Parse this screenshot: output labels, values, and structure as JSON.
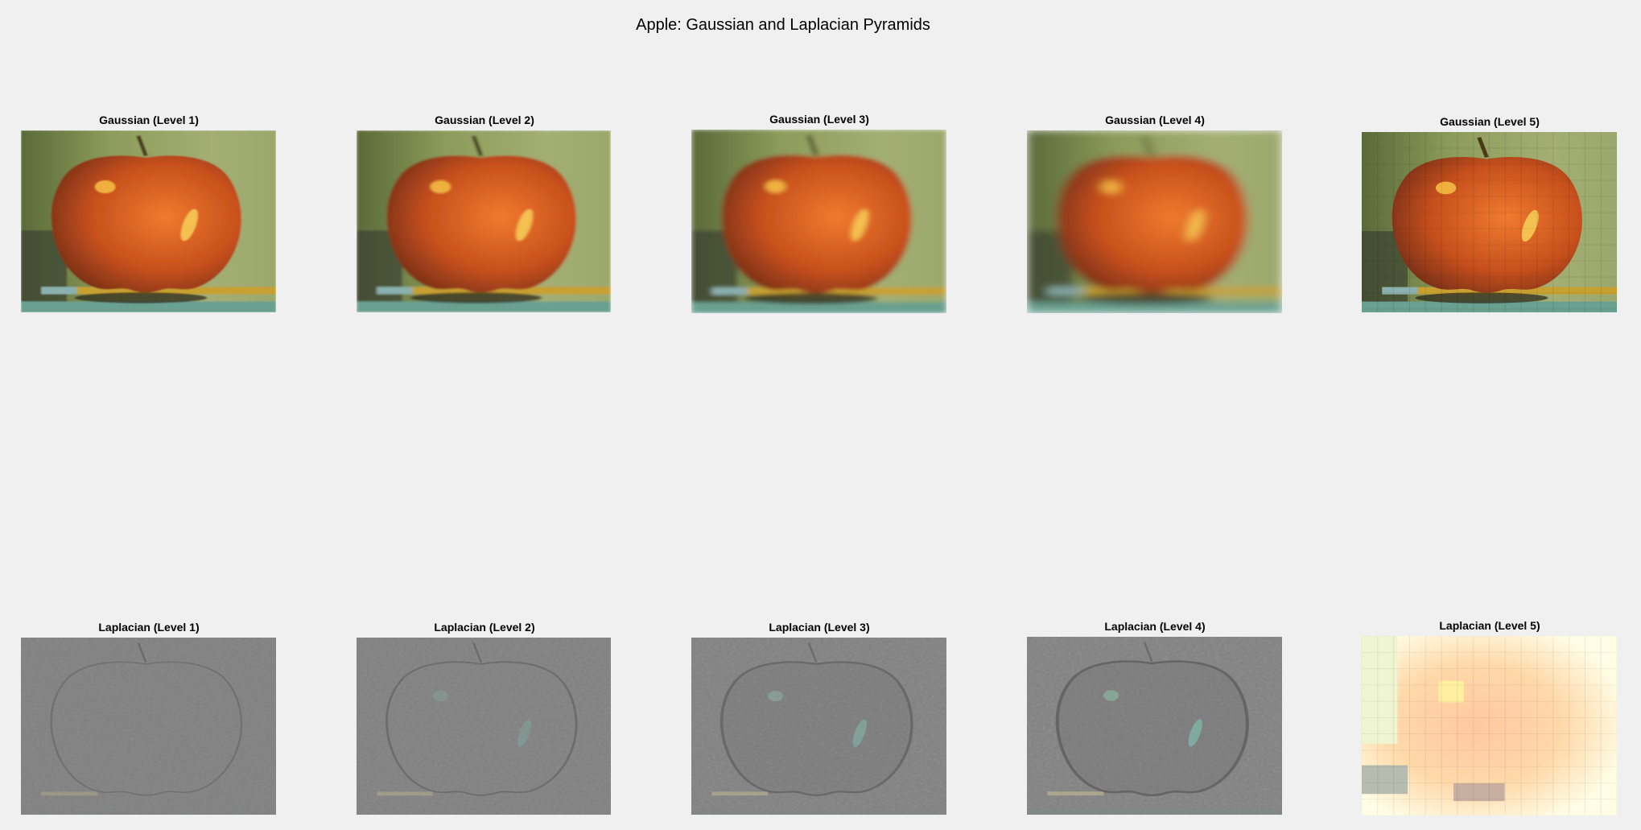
{
  "figure": {
    "title": "Apple: Gaussian and Laplacian Pyramids"
  },
  "gaussian": {
    "titles": [
      "Gaussian (Level 1)",
      "Gaussian (Level 2)",
      "Gaussian (Level 3)",
      "Gaussian (Level 4)",
      "Gaussian (Level 5)"
    ],
    "blur": [
      0.3,
      0.6,
      1.1,
      2.0,
      0
    ],
    "pixelation": [
      0,
      0,
      0,
      0,
      16
    ]
  },
  "laplacian": {
    "titles": [
      "Laplacian (Level 1)",
      "Laplacian (Level 2)",
      "Laplacian (Level 3)",
      "Laplacian (Level 4)",
      "Laplacian (Level 5)"
    ],
    "edge_strength": [
      0.15,
      0.3,
      0.5,
      0.65,
      0
    ]
  },
  "colors": {
    "background": "#f0f0f0",
    "apple_red": "#c8501c",
    "apple_highlight": "#f0b040",
    "backdrop_green": "#8c9c5a",
    "laplacian_gray": "#808080",
    "laplacian_top_bg": "#fffde6",
    "laplacian_top_apple": "#ffc8a0"
  }
}
